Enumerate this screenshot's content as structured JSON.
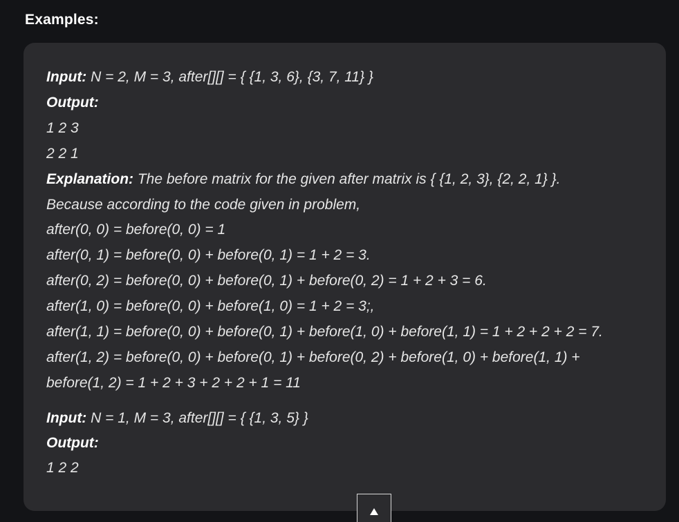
{
  "section": {
    "title": "Examples:"
  },
  "example1": {
    "input_label": "Input:",
    "input_value": " N = 2, M = 3, after[][] = { {1, 3, 6}, {3, 7, 11} }",
    "output_label": "Output:",
    "output_lines": [
      "1 2 3",
      "2 2 1"
    ],
    "explanation_label": "Explanation:",
    "explanation_text": " The before matrix for the given after matrix is { {1, 2, 3}, {2, 2, 1} }.",
    "explanation_lines": [
      "Because according to the code given in problem,",
      "after(0, 0) = before(0, 0) = 1",
      "after(0, 1) = before(0, 0) + before(0, 1) = 1 + 2 = 3.",
      "after(0, 2) = before(0, 0) + before(0, 1) + before(0, 2) = 1 + 2 + 3 = 6.",
      "after(1, 0) = before(0, 0) + before(1, 0) = 1 + 2 = 3;,",
      "after(1, 1) = before(0, 0) + before(0, 1) + before(1, 0) + before(1, 1) = 1 + 2 + 2 + 2 = 7.",
      "after(1, 2) = before(0, 0) + before(0, 1) + before(0, 2) + before(1, 0) + before(1, 1) +",
      "before(1, 2) = 1 + 2 + 3 + 2 + 2 + 1 = 11"
    ]
  },
  "example2": {
    "input_label": "Input:",
    "input_value": " N = 1, M = 3, after[][] = { {1, 3, 5} }",
    "output_label": "Output:",
    "output_lines": [
      "1 2 2"
    ]
  },
  "scroll_top": {
    "icon": "arrow-up-icon"
  }
}
